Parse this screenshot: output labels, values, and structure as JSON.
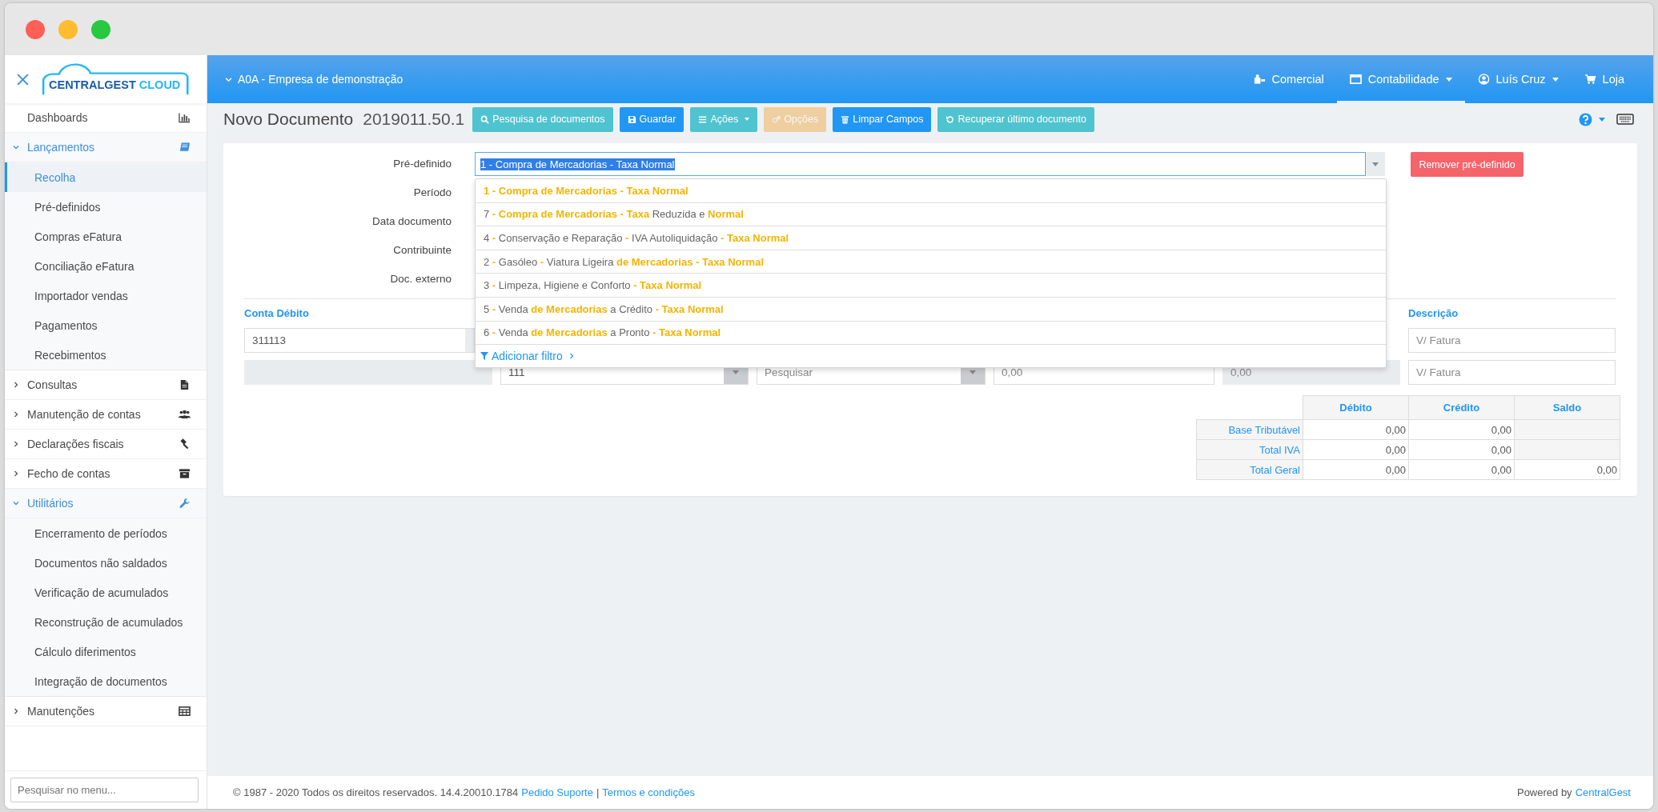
{
  "window": {
    "controls": [
      {
        "kind": "close"
      },
      {
        "kind": "minimize"
      },
      {
        "kind": "zoom"
      }
    ]
  },
  "logo": {
    "brand": "CENTRALGEST",
    "suffix": "CLOUD"
  },
  "sidebar": {
    "items": [
      {
        "label": "Dashboards",
        "selected": false
      },
      {
        "label": "Lançamentos",
        "expanded": true,
        "children": [
          {
            "label": "Recolha",
            "selected": true
          },
          {
            "label": "Pré-definidos",
            "selected": false
          },
          {
            "label": "Compras eFatura",
            "selected": false
          },
          {
            "label": "Conciliação eFatura",
            "selected": false
          },
          {
            "label": "Importador vendas",
            "selected": false
          },
          {
            "label": "Pagamentos",
            "selected": false
          },
          {
            "label": "Recebimentos",
            "selected": false
          }
        ]
      },
      {
        "label": "Consultas",
        "expanded": false
      },
      {
        "label": "Manutenção de contas",
        "expanded": false
      },
      {
        "label": "Declarações fiscais",
        "expanded": false
      },
      {
        "label": "Fecho de contas",
        "expanded": false
      },
      {
        "label": "Utilitários",
        "expanded": true,
        "children": [
          {
            "label": "Encerramento de períodos",
            "selected": false
          },
          {
            "label": "Documentos não saldados",
            "selected": false
          },
          {
            "label": "Verificação de acumulados",
            "selected": false
          },
          {
            "label": "Reconstrução de acumulados",
            "selected": false
          },
          {
            "label": "Cálculo diferimentos",
            "selected": false
          },
          {
            "label": "Integração de documentos",
            "selected": false
          }
        ]
      },
      {
        "label": "Manutenções",
        "expanded": false
      }
    ],
    "search": {
      "placeholder": "Pesquisar no menu..."
    }
  },
  "header": {
    "company": "A0A - Empresa de demonstração",
    "menus": [
      {
        "label": "Comercial",
        "has_menu": false,
        "selected": false
      },
      {
        "label": "Contabilidade",
        "has_menu": true,
        "selected": true
      },
      {
        "label": "Luís Cruz",
        "has_menu": true,
        "selected": false
      },
      {
        "label": "Loja",
        "has_menu": false,
        "selected": false
      }
    ]
  },
  "toolbar": {
    "title": "Novo Documento",
    "number": "2019011.50.1",
    "buttons": [
      {
        "label": "Pesquisa de documentos",
        "kind": "info",
        "disabled": false,
        "has_menu": false
      },
      {
        "label": "Guardar",
        "kind": "primary",
        "disabled": false,
        "has_menu": false
      },
      {
        "label": "Ações",
        "kind": "info",
        "disabled": false,
        "has_menu": true
      },
      {
        "label": "Opções",
        "kind": "warning",
        "disabled": true,
        "has_menu": false
      },
      {
        "label": "Limpar Campos",
        "kind": "primary",
        "disabled": false,
        "has_menu": false
      },
      {
        "label": "Recuperar último documento",
        "kind": "info",
        "disabled": false,
        "has_menu": false
      }
    ]
  },
  "form": {
    "fields": [
      {
        "label": "Pré-definido",
        "value": "1 - Compra de Mercadorias - Taxa Normal",
        "value_highlighted": true
      },
      {
        "label": "Período"
      },
      {
        "label": "Data documento"
      },
      {
        "label": "Contribuinte"
      },
      {
        "label": "Doc. externo"
      }
    ],
    "remove_button": "Remover pré-definido"
  },
  "dropdown": {
    "options": [
      {
        "segments": [
          {
            "text": "1 - Compra de Mercadorias - Taxa Normal",
            "match": true
          }
        ]
      },
      {
        "segments": [
          {
            "text": "7",
            "match": false
          },
          {
            "text": " - Compra de Mercadorias - Taxa",
            "match": true
          },
          {
            "text": " Reduzida e ",
            "match": false
          },
          {
            "text": "Normal",
            "match": true
          }
        ]
      },
      {
        "segments": [
          {
            "text": "4",
            "match": false
          },
          {
            "text": " - ",
            "match": true
          },
          {
            "text": "Conservação e Reparação",
            "match": false
          },
          {
            "text": " - ",
            "match": true
          },
          {
            "text": "IVA Autoliquidação",
            "match": false
          },
          {
            "text": " - Taxa Normal",
            "match": true
          }
        ]
      },
      {
        "segments": [
          {
            "text": "2",
            "match": false
          },
          {
            "text": " - ",
            "match": true
          },
          {
            "text": "Gasóleo",
            "match": false
          },
          {
            "text": " - ",
            "match": true
          },
          {
            "text": "Viatura Ligeira ",
            "match": false
          },
          {
            "text": "de Mercadorias - Taxa Normal",
            "match": true
          }
        ]
      },
      {
        "segments": [
          {
            "text": "3",
            "match": false
          },
          {
            "text": " - ",
            "match": true
          },
          {
            "text": "Limpeza, Higiene e Conforto",
            "match": false
          },
          {
            "text": " - Taxa Normal",
            "match": true
          }
        ]
      },
      {
        "segments": [
          {
            "text": "5",
            "match": false
          },
          {
            "text": " - ",
            "match": true
          },
          {
            "text": "Venda ",
            "match": false
          },
          {
            "text": "de Mercadorias",
            "match": true
          },
          {
            "text": " a Crédito",
            "match": false
          },
          {
            "text": " - Taxa Normal",
            "match": true
          }
        ]
      },
      {
        "segments": [
          {
            "text": "6",
            "match": false
          },
          {
            "text": " - ",
            "match": true
          },
          {
            "text": "Venda ",
            "match": false
          },
          {
            "text": "de Mercadorias",
            "match": true
          },
          {
            "text": " a Pronto",
            "match": false
          },
          {
            "text": " - Taxa Normal",
            "match": true
          }
        ]
      }
    ],
    "filter_link": "Adicionar filtro"
  },
  "lines": {
    "headers": {
      "account": "Conta Débito",
      "description": "Descrição"
    },
    "rows": [
      {
        "account": "311113",
        "description": "V/ Fatura"
      },
      {
        "column_2": "111",
        "column_3": {
          "placeholder": "Pesquisar"
        },
        "column_4": "0,00",
        "column_5": "0,00",
        "description": "V/ Fatura"
      }
    ]
  },
  "totals": {
    "columns": [
      "Débito",
      "Crédito",
      "Saldo"
    ],
    "rows": [
      {
        "label": "Base Tributável",
        "debit": "0,00",
        "credit": "0,00"
      },
      {
        "label": "Total IVA",
        "debit": "0,00",
        "credit": "0,00"
      },
      {
        "label": "Total Geral",
        "debit": "0,00",
        "credit": "0,00",
        "balance": "0,00"
      }
    ]
  },
  "footer": {
    "copyright": "© 1987 - 2020 Todos os direitos reservados. 14.4.20010.1784",
    "links": [
      "Pedido Suporte",
      "Termos e condições"
    ],
    "separator": "|",
    "powered_by": "Powered by",
    "powered_link": "CentralGest"
  }
}
